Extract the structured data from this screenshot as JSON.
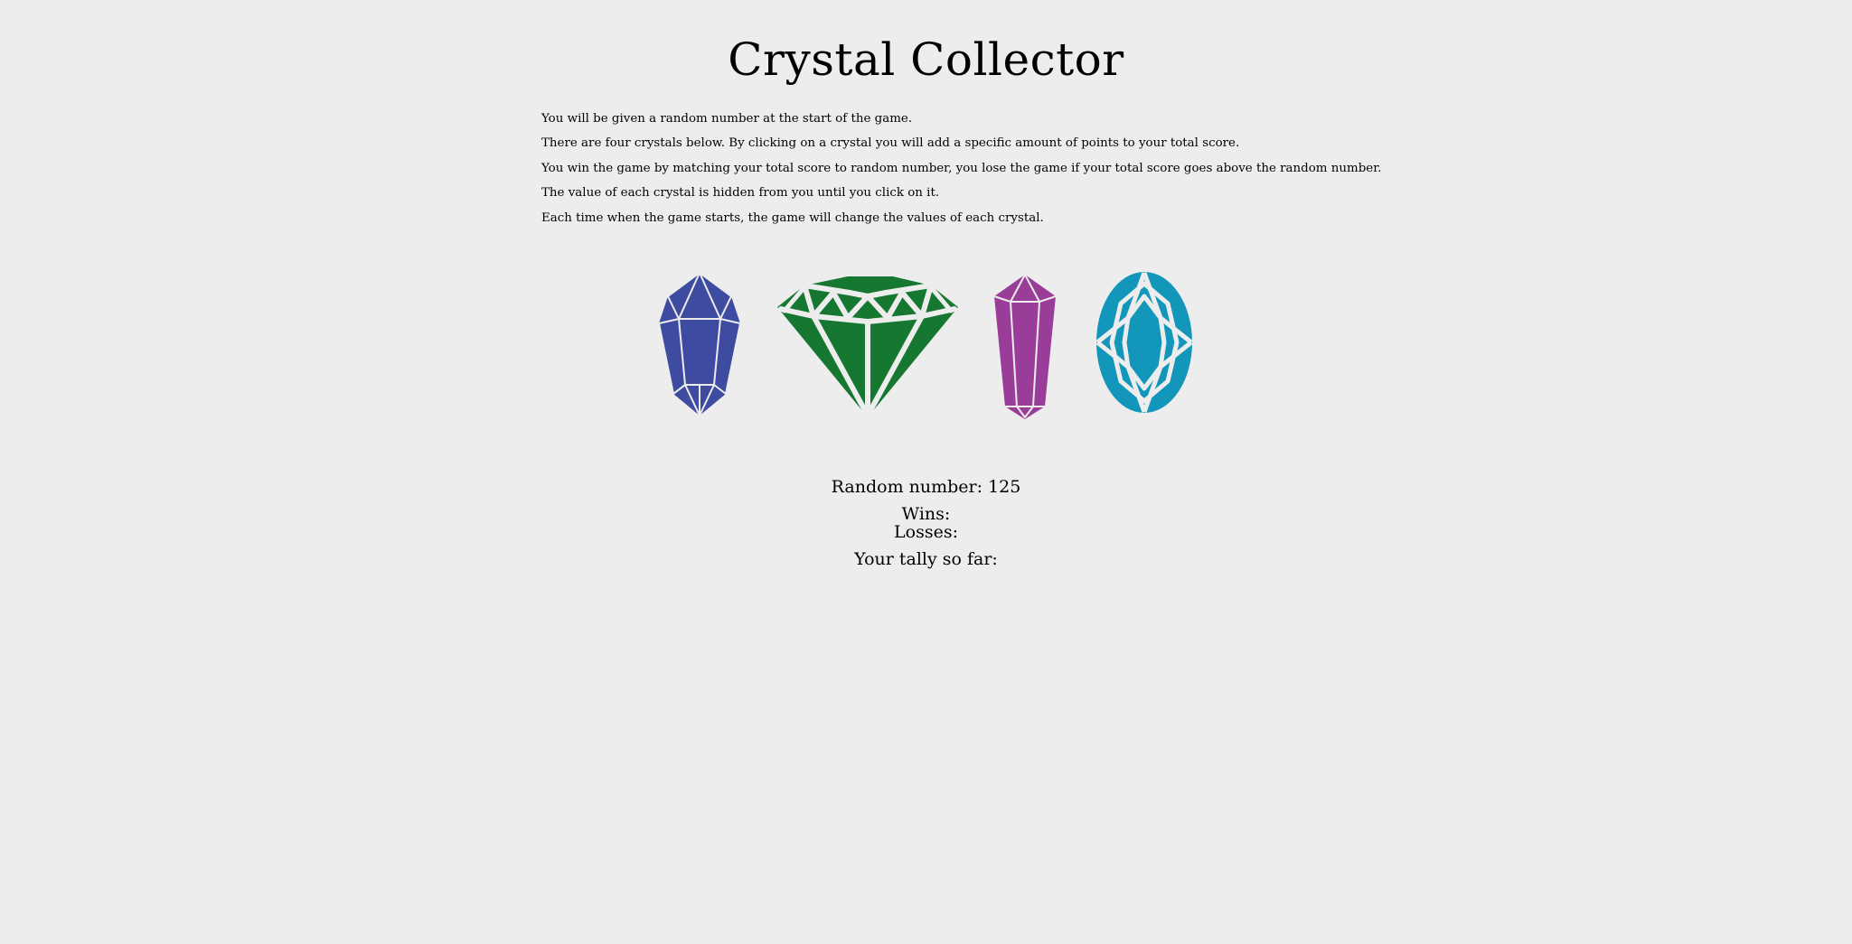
{
  "title": "Crystal Collector",
  "instructions": [
    "You will be given a random number at the start of the game.",
    "There are four crystals below. By clicking on a crystal you will add a specific amount of points to your total score.",
    "You win the game by matching your total score to random number, you lose the game if your total score goes above the random number.",
    "The value of each crystal is hidden from you until you click on it.",
    "Each time when the game starts, the game will change the values of each crystal."
  ],
  "crystals": [
    {
      "name": "blue-crystal",
      "color": "#3d4ba0"
    },
    {
      "name": "green-crystal",
      "color": "#167730"
    },
    {
      "name": "purple-crystal",
      "color": "#9a3d98"
    },
    {
      "name": "teal-crystal",
      "color": "#1296b9"
    }
  ],
  "stats": {
    "random_label": "Random number: ",
    "random_value": "125",
    "wins_label": "Wins:",
    "wins_value": "",
    "losses_label": "Losses:",
    "losses_value": "",
    "tally_label": "Your tally so far:",
    "tally_value": ""
  },
  "colors": {
    "background": "#ededed",
    "facet_lines": "#ededed"
  }
}
